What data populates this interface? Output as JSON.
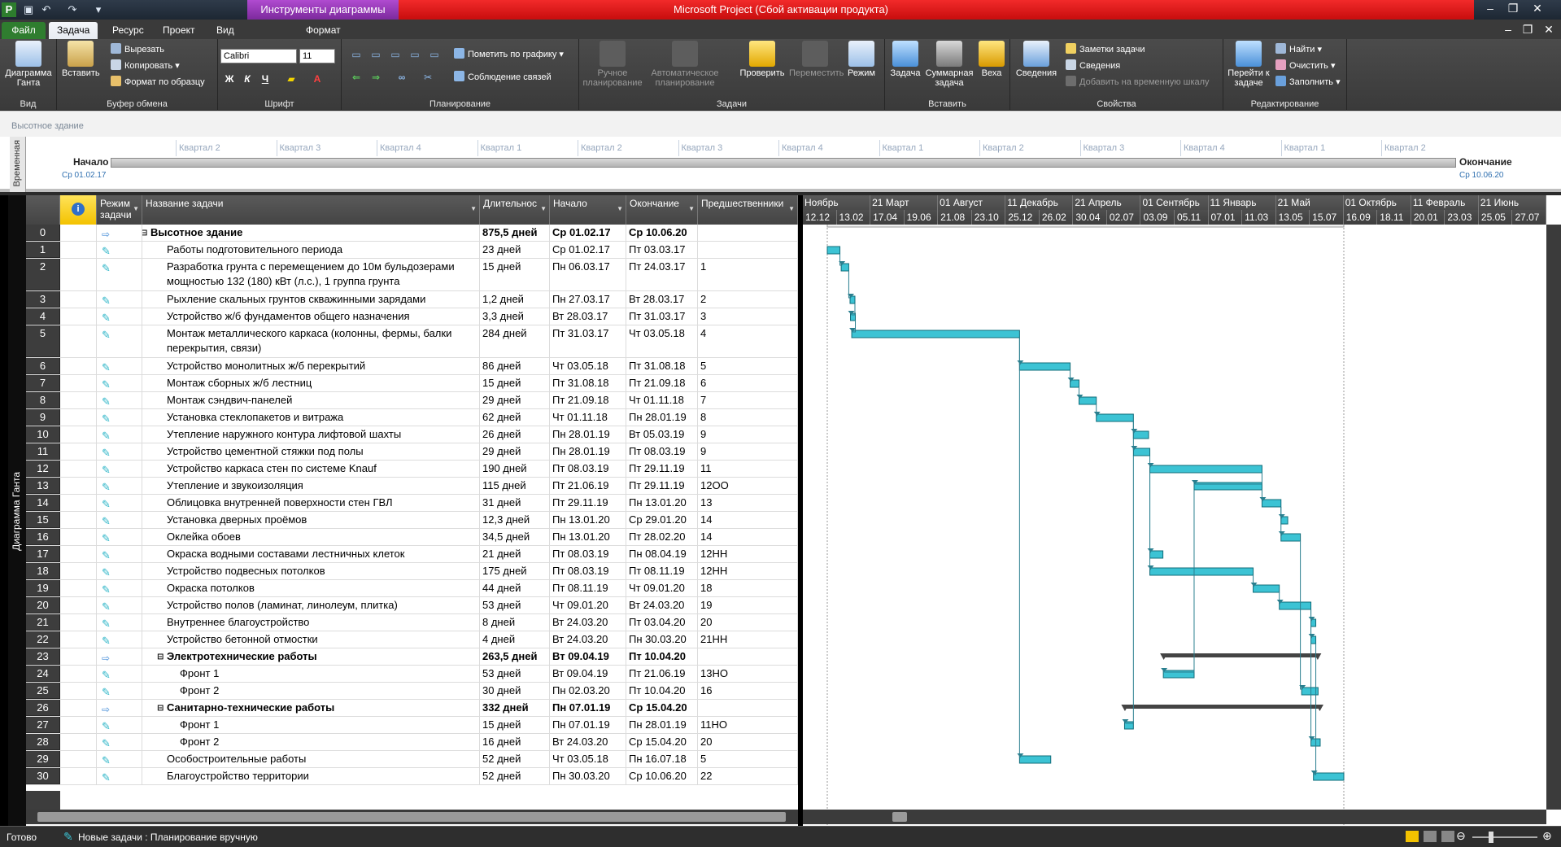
{
  "window": {
    "title": "Microsoft Project (Сбой активации продукта)",
    "context_tool": "Инструменты диаграммы Ганта"
  },
  "tabs": [
    "Файл",
    "Задача",
    "Ресурс",
    "Проект",
    "Вид",
    "Формат"
  ],
  "ribbon": {
    "view": {
      "gantt": "Диаграмма Ганта",
      "group": "Вид"
    },
    "clipboard": {
      "paste": "Вставить",
      "cut": "Вырезать",
      "copy": "Копировать",
      "format_painter": "Формат по образцу",
      "group": "Буфер обмена"
    },
    "font": {
      "name": "Calibri",
      "size": "11",
      "bold": "Ж",
      "italic": "К",
      "underline": "Ч",
      "group": "Шрифт"
    },
    "schedule": {
      "mark_on_track": "Пометить по графику",
      "respect_links": "Соблюдение связей",
      "group": "Планирование"
    },
    "tasks": {
      "manual": "Ручное планирование",
      "auto": "Автоматическое планирование",
      "inspect": "Проверить",
      "move": "Переместить",
      "mode": "Режим",
      "group": "Задачи"
    },
    "insert": {
      "task": "Задача",
      "summary": "Суммарная задача",
      "milestone": "Веха",
      "group": "Вставить"
    },
    "properties": {
      "info": "Сведения",
      "notes": "Заметки задачи",
      "details": "Сведения",
      "add_timeline": "Добавить на временную шкалу",
      "group": "Свойства"
    },
    "editing": {
      "goto": "Перейти к задаче",
      "find": "Найти",
      "clear": "Очистить",
      "fill": "Заполнить",
      "group": "Редактирование"
    }
  },
  "timeline": {
    "project_name": "Высотное здание",
    "side_label": "Временная",
    "start_label": "Начало",
    "start_date": "Ср 01.02.17",
    "end_label": "Окончание",
    "end_date": "Ср 10.06.20",
    "quarters": [
      "Квартал 2",
      "Квартал 3",
      "Квартал 4",
      "Квартал 1",
      "Квартал 2",
      "Квартал 3",
      "Квартал 4",
      "Квартал 1",
      "Квартал 2",
      "Квартал 3",
      "Квартал 4",
      "Квартал 1",
      "Квартал 2"
    ]
  },
  "view_label": "Диаграмма Ганта",
  "columns": {
    "mode": "Режим задачи",
    "name": "Название задачи",
    "duration": "Длительнос",
    "start": "Начало",
    "finish": "Окончание",
    "pred": "Предшественники"
  },
  "tasks": [
    {
      "id": "0",
      "name": "Высотное здание",
      "dur": "875,5 дней",
      "start": "Ср 01.02.17",
      "finish": "Ср 10.06.20",
      "pred": "",
      "type": "project"
    },
    {
      "id": "1",
      "name": "Работы подготовительного периода",
      "dur": "23 дней",
      "start": "Ср 01.02.17",
      "finish": "Пт 03.03.17",
      "pred": ""
    },
    {
      "id": "2",
      "name": "Разработка грунта с перемещением до 10м бульдозерами мощностью 132 (180) кВт (л.с.), 1 группа грунта",
      "dur": "15 дней",
      "start": "Пн 06.03.17",
      "finish": "Пт 24.03.17",
      "pred": "1"
    },
    {
      "id": "3",
      "name": "Рыхление скальных грунтов скважинными зарядами",
      "dur": "1,2 дней",
      "start": "Пн 27.03.17",
      "finish": "Вт 28.03.17",
      "pred": "2"
    },
    {
      "id": "4",
      "name": "Устройство ж/б фундаментов общего назначения",
      "dur": "3,3 дней",
      "start": "Вт 28.03.17",
      "finish": "Пт 31.03.17",
      "pred": "3"
    },
    {
      "id": "5",
      "name": "Монтаж металлического каркаса (колонны, фермы, балки перекрытия, связи)",
      "dur": "284 дней",
      "start": "Пт 31.03.17",
      "finish": "Чт 03.05.18",
      "pred": "4"
    },
    {
      "id": "6",
      "name": "Устройство монолитных ж/б перекрытий",
      "dur": "86 дней",
      "start": "Чт 03.05.18",
      "finish": "Пт 31.08.18",
      "pred": "5"
    },
    {
      "id": "7",
      "name": "Монтаж сборных ж/б лестниц",
      "dur": "15 дней",
      "start": "Пт 31.08.18",
      "finish": "Пт 21.09.18",
      "pred": "6"
    },
    {
      "id": "8",
      "name": "Монтаж сэндвич-панелей",
      "dur": "29 дней",
      "start": "Пт 21.09.18",
      "finish": "Чт 01.11.18",
      "pred": "7"
    },
    {
      "id": "9",
      "name": "Установка стеклопакетов и витража",
      "dur": "62 дней",
      "start": "Чт 01.11.18",
      "finish": "Пн 28.01.19",
      "pred": "8"
    },
    {
      "id": "10",
      "name": "Утепление наружного контура лифтовой шахты",
      "dur": "26 дней",
      "start": "Пн 28.01.19",
      "finish": "Вт 05.03.19",
      "pred": "9"
    },
    {
      "id": "11",
      "name": "Устройство цементной стяжки под полы",
      "dur": "29 дней",
      "start": "Пн 28.01.19",
      "finish": "Пт 08.03.19",
      "pred": "9"
    },
    {
      "id": "12",
      "name": "Устройство каркаса стен по системе Knauf",
      "dur": "190 дней",
      "start": "Пт 08.03.19",
      "finish": "Пт 29.11.19",
      "pred": "11"
    },
    {
      "id": "13",
      "name": "Утепление и звукоизоляция",
      "dur": "115 дней",
      "start": "Пт 21.06.19",
      "finish": "Пт 29.11.19",
      "pred": "12ОО"
    },
    {
      "id": "14",
      "name": "Облицовка внутренней поверхности стен ГВЛ",
      "dur": "31 дней",
      "start": "Пт 29.11.19",
      "finish": "Пн 13.01.20",
      "pred": "13"
    },
    {
      "id": "15",
      "name": "Установка дверных проёмов",
      "dur": "12,3 дней",
      "start": "Пн 13.01.20",
      "finish": "Ср 29.01.20",
      "pred": "14"
    },
    {
      "id": "16",
      "name": "Оклейка обоев",
      "dur": "34,5 дней",
      "start": "Пн 13.01.20",
      "finish": "Пт 28.02.20",
      "pred": "14"
    },
    {
      "id": "17",
      "name": "Окраска водными составами лестничных клеток",
      "dur": "21 дней",
      "start": "Пт 08.03.19",
      "finish": "Пн 08.04.19",
      "pred": "12НН"
    },
    {
      "id": "18",
      "name": "Устройство подвесных потолков",
      "dur": "175 дней",
      "start": "Пт 08.03.19",
      "finish": "Пт 08.11.19",
      "pred": "12НН"
    },
    {
      "id": "19",
      "name": "Окраска потолков",
      "dur": "44 дней",
      "start": "Пт 08.11.19",
      "finish": "Чт 09.01.20",
      "pred": "18"
    },
    {
      "id": "20",
      "name": "Устройство полов (ламинат, линолеум, плитка)",
      "dur": "53 дней",
      "start": "Чт 09.01.20",
      "finish": "Вт 24.03.20",
      "pred": "19"
    },
    {
      "id": "21",
      "name": "Внутреннее благоустройство",
      "dur": "8 дней",
      "start": "Вт 24.03.20",
      "finish": "Пт 03.04.20",
      "pred": "20"
    },
    {
      "id": "22",
      "name": "Устройство бетонной отмостки",
      "dur": "4 дней",
      "start": "Вт 24.03.20",
      "finish": "Пн 30.03.20",
      "pred": "21НН"
    },
    {
      "id": "23",
      "name": "Электротехнические работы",
      "dur": "263,5 дней",
      "start": "Вт 09.04.19",
      "finish": "Пт 10.04.20",
      "pred": "",
      "type": "summary"
    },
    {
      "id": "24",
      "name": "Фронт 1",
      "dur": "53 дней",
      "start": "Вт 09.04.19",
      "finish": "Пт 21.06.19",
      "pred": "13НО",
      "type": "sub"
    },
    {
      "id": "25",
      "name": "Фронт 2",
      "dur": "30 дней",
      "start": "Пн 02.03.20",
      "finish": "Пт 10.04.20",
      "pred": "16",
      "type": "sub"
    },
    {
      "id": "26",
      "name": "Санитарно-технические работы",
      "dur": "332 дней",
      "start": "Пн 07.01.19",
      "finish": "Ср 15.04.20",
      "pred": "",
      "type": "summary"
    },
    {
      "id": "27",
      "name": "Фронт 1",
      "dur": "15 дней",
      "start": "Пн 07.01.19",
      "finish": "Пн 28.01.19",
      "pred": "11НО",
      "type": "sub"
    },
    {
      "id": "28",
      "name": "Фронт 2",
      "dur": "16 дней",
      "start": "Вт 24.03.20",
      "finish": "Ср 15.04.20",
      "pred": "20",
      "type": "sub"
    },
    {
      "id": "29",
      "name": "Особостроительные работы",
      "dur": "52 дней",
      "start": "Чт 03.05.18",
      "finish": "Пн 16.07.18",
      "pred": "5"
    },
    {
      "id": "30",
      "name": "Благоустройство территории",
      "dur": "52 дней",
      "start": "Пн 30.03.20",
      "finish": "Ср 10.06.20",
      "pred": "22"
    }
  ],
  "gantt_scale": {
    "top": [
      "Ноябрь",
      "21 Март",
      "01 Август",
      "11 Декабрь",
      "21 Апрель",
      "01 Сентябрь",
      "11 Январь",
      "21 Май",
      "01 Октябрь",
      "11 Февраль",
      "21 Июнь"
    ],
    "bottom": [
      "12.12",
      "13.02",
      "17.04",
      "19.06",
      "21.08",
      "23.10",
      "25.12",
      "26.02",
      "30.04",
      "02.07",
      "03.09",
      "05.11",
      "07.01",
      "11.03",
      "13.05",
      "15.07",
      "16.09",
      "18.11",
      "20.01",
      "23.03",
      "25.05",
      "27.07"
    ]
  },
  "status": {
    "ready": "Готово",
    "new_tasks": "Новые задачи : Планирование вручную"
  },
  "colors": {
    "bar": "#3cc3d4",
    "summary": "#444444",
    "title_red": "#e31b1b"
  }
}
